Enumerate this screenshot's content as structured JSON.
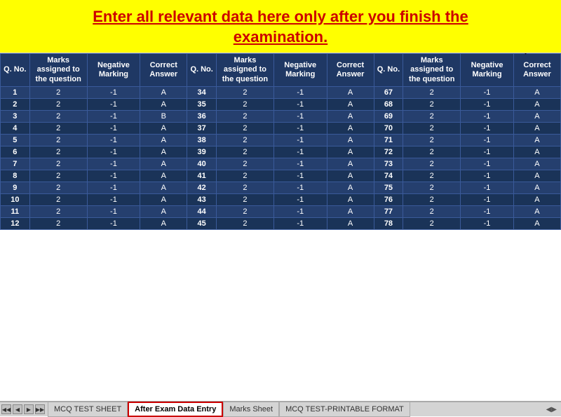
{
  "header": {
    "line1": "Enter all relevant data here only after you finish the",
    "line2": "examination."
  },
  "columns": {
    "qno": "Q. No.",
    "marks": "Marks assigned to the question",
    "negative": "Negative Marking",
    "answer": "Correct Answer"
  },
  "section1": [
    {
      "qno": 1,
      "marks": 2,
      "neg": -1,
      "ans": "A"
    },
    {
      "qno": 2,
      "marks": 2,
      "neg": -1,
      "ans": "A"
    },
    {
      "qno": 3,
      "marks": 2,
      "neg": -1,
      "ans": "B"
    },
    {
      "qno": 4,
      "marks": 2,
      "neg": -1,
      "ans": "A"
    },
    {
      "qno": 5,
      "marks": 2,
      "neg": -1,
      "ans": "A"
    },
    {
      "qno": 6,
      "marks": 2,
      "neg": -1,
      "ans": "A"
    },
    {
      "qno": 7,
      "marks": 2,
      "neg": -1,
      "ans": "A"
    },
    {
      "qno": 8,
      "marks": 2,
      "neg": -1,
      "ans": "A"
    },
    {
      "qno": 9,
      "marks": 2,
      "neg": -1,
      "ans": "A"
    },
    {
      "qno": 10,
      "marks": 2,
      "neg": -1,
      "ans": "A"
    },
    {
      "qno": 11,
      "marks": 2,
      "neg": -1,
      "ans": "A"
    },
    {
      "qno": 12,
      "marks": 2,
      "neg": -1,
      "ans": "A"
    }
  ],
  "section2": [
    {
      "qno": 34,
      "marks": 2,
      "neg": -1,
      "ans": "A"
    },
    {
      "qno": 35,
      "marks": 2,
      "neg": -1,
      "ans": "A"
    },
    {
      "qno": 36,
      "marks": 2,
      "neg": -1,
      "ans": "A"
    },
    {
      "qno": 37,
      "marks": 2,
      "neg": -1,
      "ans": "A"
    },
    {
      "qno": 38,
      "marks": 2,
      "neg": -1,
      "ans": "A"
    },
    {
      "qno": 39,
      "marks": 2,
      "neg": -1,
      "ans": "A"
    },
    {
      "qno": 40,
      "marks": 2,
      "neg": -1,
      "ans": "A"
    },
    {
      "qno": 41,
      "marks": 2,
      "neg": -1,
      "ans": "A"
    },
    {
      "qno": 42,
      "marks": 2,
      "neg": -1,
      "ans": "A"
    },
    {
      "qno": 43,
      "marks": 2,
      "neg": -1,
      "ans": "A"
    },
    {
      "qno": 44,
      "marks": 2,
      "neg": -1,
      "ans": "A"
    },
    {
      "qno": 45,
      "marks": 2,
      "neg": -1,
      "ans": "A"
    }
  ],
  "section3": [
    {
      "qno": 67,
      "marks": 2,
      "neg": -1,
      "ans": "A"
    },
    {
      "qno": 68,
      "marks": 2,
      "neg": -1,
      "ans": "A"
    },
    {
      "qno": 69,
      "marks": 2,
      "neg": -1,
      "ans": "A"
    },
    {
      "qno": 70,
      "marks": 2,
      "neg": -1,
      "ans": "A"
    },
    {
      "qno": 71,
      "marks": 2,
      "neg": -1,
      "ans": "A"
    },
    {
      "qno": 72,
      "marks": 2,
      "neg": -1,
      "ans": "A"
    },
    {
      "qno": 73,
      "marks": 2,
      "neg": -1,
      "ans": "A"
    },
    {
      "qno": 74,
      "marks": 2,
      "neg": -1,
      "ans": "A"
    },
    {
      "qno": 75,
      "marks": 2,
      "neg": -1,
      "ans": "A"
    },
    {
      "qno": 76,
      "marks": 2,
      "neg": -1,
      "ans": "A"
    },
    {
      "qno": 77,
      "marks": 2,
      "neg": -1,
      "ans": "A"
    },
    {
      "qno": 78,
      "marks": 2,
      "neg": -1,
      "ans": "A"
    }
  ],
  "tabs": [
    {
      "label": "MCQ TEST SHEET",
      "active": false
    },
    {
      "label": "After Exam Data Entry",
      "active": true
    },
    {
      "label": "Marks Sheet",
      "active": false
    },
    {
      "label": "MCQ TEST-PRINTABLE FORMAT",
      "active": false
    }
  ]
}
